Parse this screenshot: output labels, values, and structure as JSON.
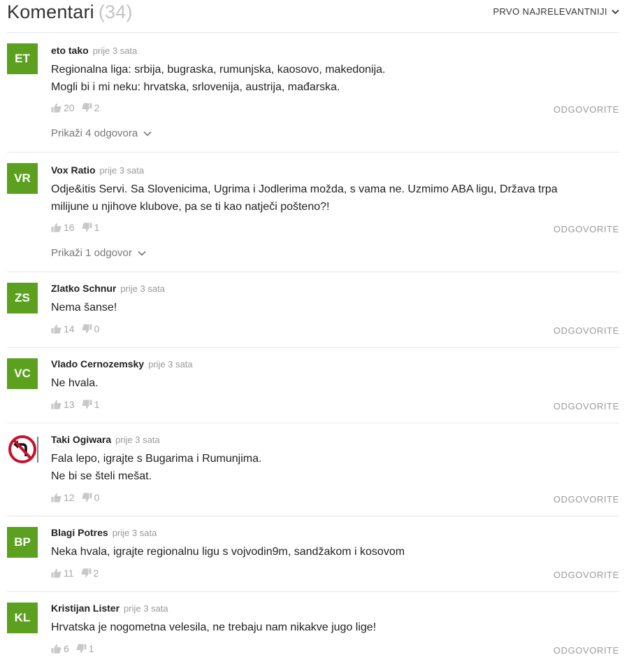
{
  "header": {
    "title": "Komentari",
    "count": "(34)",
    "sort_label": "PRVO NAJRELEVANTNIJI"
  },
  "colors": {
    "avatar_green": "#5ba11f",
    "muted": "#999999",
    "divider": "#e6e6e6"
  },
  "reply_label": "ODGOVORITE",
  "comments": [
    {
      "initials": "ET",
      "author": "eto tako",
      "time": "prije 3 sata",
      "lines": [
        "Regionalna liga: srbija, bugraska, rumunjska, kaosovo, makedonija.",
        "Mogli bi i mi neku: hrvatska, srlovenija, austrija, mađarska."
      ],
      "likes": "20",
      "dislikes": "2",
      "show_replies": "Prikaži 4 odgovora"
    },
    {
      "initials": "VR",
      "author": "Vox Ratio",
      "time": "prije 3 sata",
      "lines": [
        "Odje&itis Servi. Sa Slovenicima, Ugrima i Jodlerima možda, s vama ne. Uzmimo ABA ligu, Država trpa",
        "milijune u njihove klubove, pa se ti kao natječi pošteno?!"
      ],
      "likes": "16",
      "dislikes": "1",
      "show_replies": "Prikaži 1 odgovor"
    },
    {
      "initials": "ZS",
      "author": "Zlatko Schnur",
      "time": "prije 3 sata",
      "lines": [
        "Nema šanse!"
      ],
      "likes": "14",
      "dislikes": "0"
    },
    {
      "initials": "VC",
      "author": "Vlado Cernozemsky",
      "time": "prije 3 sata",
      "lines": [
        "Ne hvala."
      ],
      "likes": "13",
      "dislikes": "1"
    },
    {
      "avatar_icon": "no-left-turn-sign-icon",
      "author": "Taki Ogiwara",
      "time": "prije 3 sata",
      "lines": [
        "Fala lepo, igrajte s Bugarima i Rumunjima.",
        "Ne bi se šteli mešat."
      ],
      "likes": "12",
      "dislikes": "0"
    },
    {
      "initials": "BP",
      "author": "Blagi Potres",
      "time": "prije 3 sata",
      "lines": [
        "Neka hvala, igrajte regionalnu ligu s vojvodin9m, sandžakom i kosovom"
      ],
      "likes": "11",
      "dislikes": "2"
    },
    {
      "initials": "KL",
      "author": "Kristijan Lister",
      "time": "prije 3 sata",
      "lines": [
        "Hrvatska je nogometna velesila, ne trebaju nam nikakve jugo lige!"
      ],
      "likes": "6",
      "dislikes": "1"
    }
  ]
}
